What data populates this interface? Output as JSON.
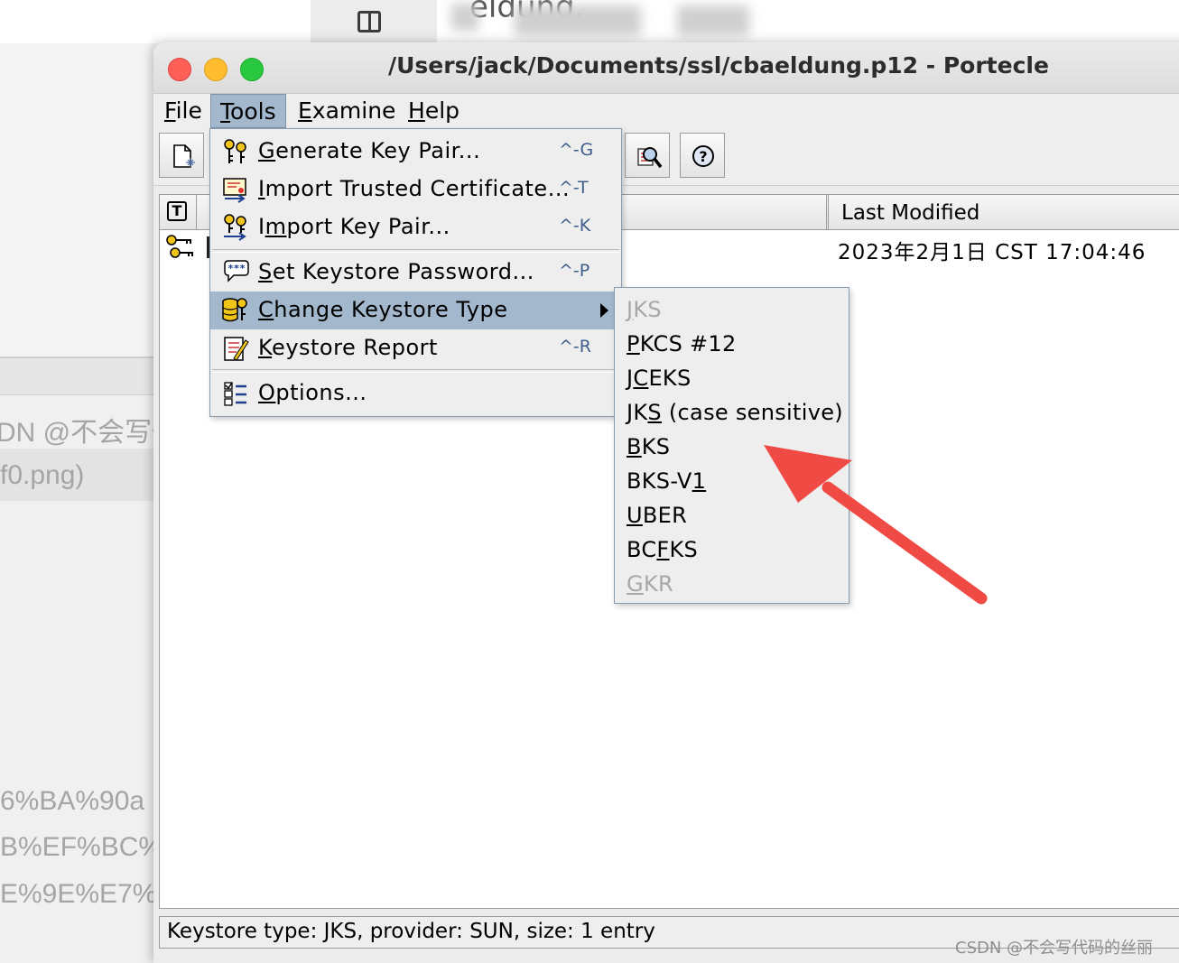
{
  "background": {
    "behind_title_text": "eldung.",
    "left_texts": [
      "DN @不会写代",
      "f0.png)",
      "6%BA%90a",
      "B%EF%BC%",
      "E%9E%E7%"
    ]
  },
  "window": {
    "title": "/Users/jack/Documents/ssl/cbaeldung.p12 - Portecle"
  },
  "menubar": {
    "items": [
      {
        "mnemonic": "F",
        "rest": "ile"
      },
      {
        "mnemonic": "T",
        "rest": "ools"
      },
      {
        "mnemonic": "E",
        "rest": "xamine"
      },
      {
        "mnemonic": "H",
        "rest": "elp"
      }
    ]
  },
  "tools_menu": {
    "items": [
      {
        "mnemonic": "G",
        "rest": "enerate Key Pair...",
        "accelerator": "^-G",
        "icon": "keypair-icon"
      },
      {
        "prefix": "",
        "mnemonic": "I",
        "rest": "mport Trusted Certificate...",
        "accelerator": "^-T",
        "icon": "certificate-import-icon"
      },
      {
        "prefix": "I",
        "mnemonic": "m",
        "rest": "port Key Pair...",
        "accelerator": "^-K",
        "icon": "keypair-import-icon"
      },
      {
        "mnemonic": "S",
        "rest": "et Keystore Password...",
        "accelerator": "^-P",
        "icon": "password-icon"
      },
      {
        "mnemonic": "C",
        "rest": "hange Keystore Type",
        "accelerator": "",
        "icon": "keystore-type-icon"
      },
      {
        "mnemonic": "K",
        "rest": "eystore Report",
        "accelerator": "^-R",
        "icon": "report-icon"
      },
      {
        "mnemonic": "O",
        "rest": "ptions...",
        "accelerator": "",
        "icon": "options-icon"
      }
    ]
  },
  "keystore_type_submenu": {
    "items": [
      {
        "pre": "",
        "u": "J",
        "post": "KS",
        "enabled": false
      },
      {
        "pre": "",
        "u": "P",
        "post": "KCS #12",
        "enabled": true
      },
      {
        "pre": "J",
        "u": "C",
        "post": "EKS",
        "enabled": true
      },
      {
        "pre": "JK",
        "u": "S",
        "post": " (case sensitive)",
        "enabled": true
      },
      {
        "pre": "",
        "u": "B",
        "post": "KS",
        "enabled": true
      },
      {
        "pre": "BKS-V",
        "u": "1",
        "post": "",
        "enabled": true
      },
      {
        "pre": "",
        "u": "U",
        "post": "BER",
        "enabled": true
      },
      {
        "pre": "BC",
        "u": "F",
        "post": "KS",
        "enabled": true
      },
      {
        "pre": "",
        "u": "G",
        "post": "KR",
        "enabled": false
      }
    ]
  },
  "table": {
    "type_header": "T",
    "last_modified_header": "Last Modified",
    "rows": [
      {
        "last_modified": "2023年2月1日 CST 17:04:46"
      }
    ]
  },
  "status": {
    "text": "Keystore type: JKS, provider: SUN, size: 1 entry"
  },
  "watermark": "CSDN @不会写代码的丝丽",
  "colors": {
    "menu_highlight": "#a3b8cc",
    "annotation_arrow": "#f04a45",
    "accelerator": "#3e5d8a"
  }
}
